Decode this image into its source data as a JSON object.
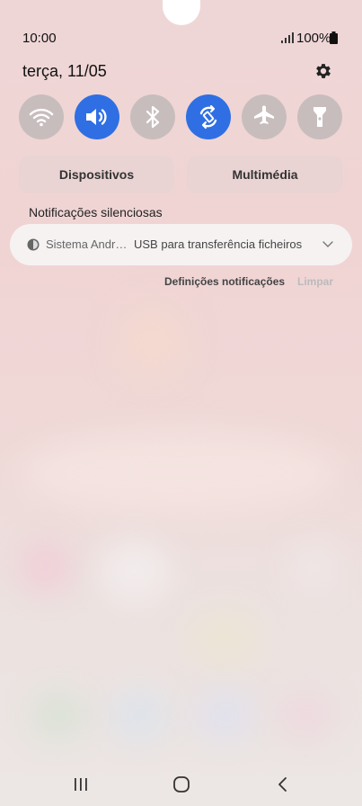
{
  "status": {
    "time": "10:00",
    "battery": "100%"
  },
  "header": {
    "date": "terça, 11/05"
  },
  "quick_toggles": [
    {
      "name": "wifi",
      "icon": "wifi-icon",
      "state": "off"
    },
    {
      "name": "sound",
      "icon": "sound-icon",
      "state": "on"
    },
    {
      "name": "bluetooth",
      "icon": "bluetooth-icon",
      "state": "off"
    },
    {
      "name": "auto-rotate",
      "icon": "auto-rotate-icon",
      "state": "on"
    },
    {
      "name": "airplane",
      "icon": "airplane-icon",
      "state": "off"
    },
    {
      "name": "flashlight",
      "icon": "flashlight-icon",
      "state": "off"
    }
  ],
  "buttons": {
    "devices": "Dispositivos",
    "media": "Multimédia"
  },
  "notifications": {
    "section_label": "Notificações silenciosas",
    "items": [
      {
        "app": "Sistema Andr…",
        "text": "USB para transferência ficheiros"
      }
    ],
    "settings_label": "Definições notificações",
    "clear_label": "Limpar"
  },
  "colors": {
    "accent": "#2f6fe3",
    "toggle_off": "#c8bdbd"
  }
}
